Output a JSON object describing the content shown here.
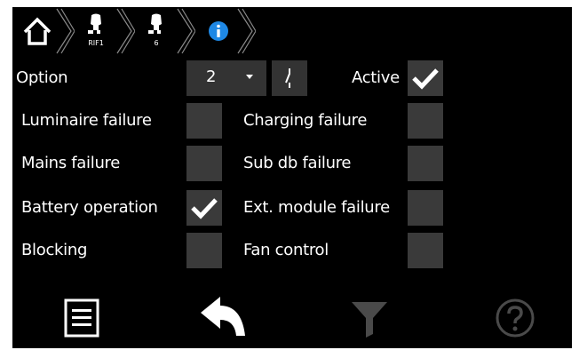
{
  "breadcrumb": {
    "items": [
      {
        "icon": "home-icon"
      },
      {
        "icon": "plug-icon",
        "label": "RIF1"
      },
      {
        "icon": "plug-icon",
        "label": "6"
      },
      {
        "icon": "info-icon"
      }
    ]
  },
  "option": {
    "label": "Option",
    "value": "2",
    "active_label": "Active",
    "active_checked": true
  },
  "left_items": [
    {
      "label": "Luminaire failure",
      "checked": false
    },
    {
      "label": "Mains failure",
      "checked": false
    },
    {
      "label": "Battery operation",
      "checked": true
    },
    {
      "label": "Blocking",
      "checked": false
    }
  ],
  "right_items": [
    {
      "label": "Charging failure",
      "checked": false
    },
    {
      "label": "Sub db failure",
      "checked": false
    },
    {
      "label": "Ext. module failure",
      "checked": false
    },
    {
      "label": "Fan control",
      "checked": false
    }
  ],
  "toolbar": [
    {
      "icon": "menu-list-icon"
    },
    {
      "icon": "back-arrow-icon"
    },
    {
      "icon": "filter-icon",
      "disabled": true
    },
    {
      "icon": "help-icon",
      "disabled": true
    }
  ],
  "colors": {
    "background": "#000000",
    "checkbox": "#3a3a3a",
    "info_accent": "#1e88e5",
    "disabled": "#4a4a4a"
  }
}
